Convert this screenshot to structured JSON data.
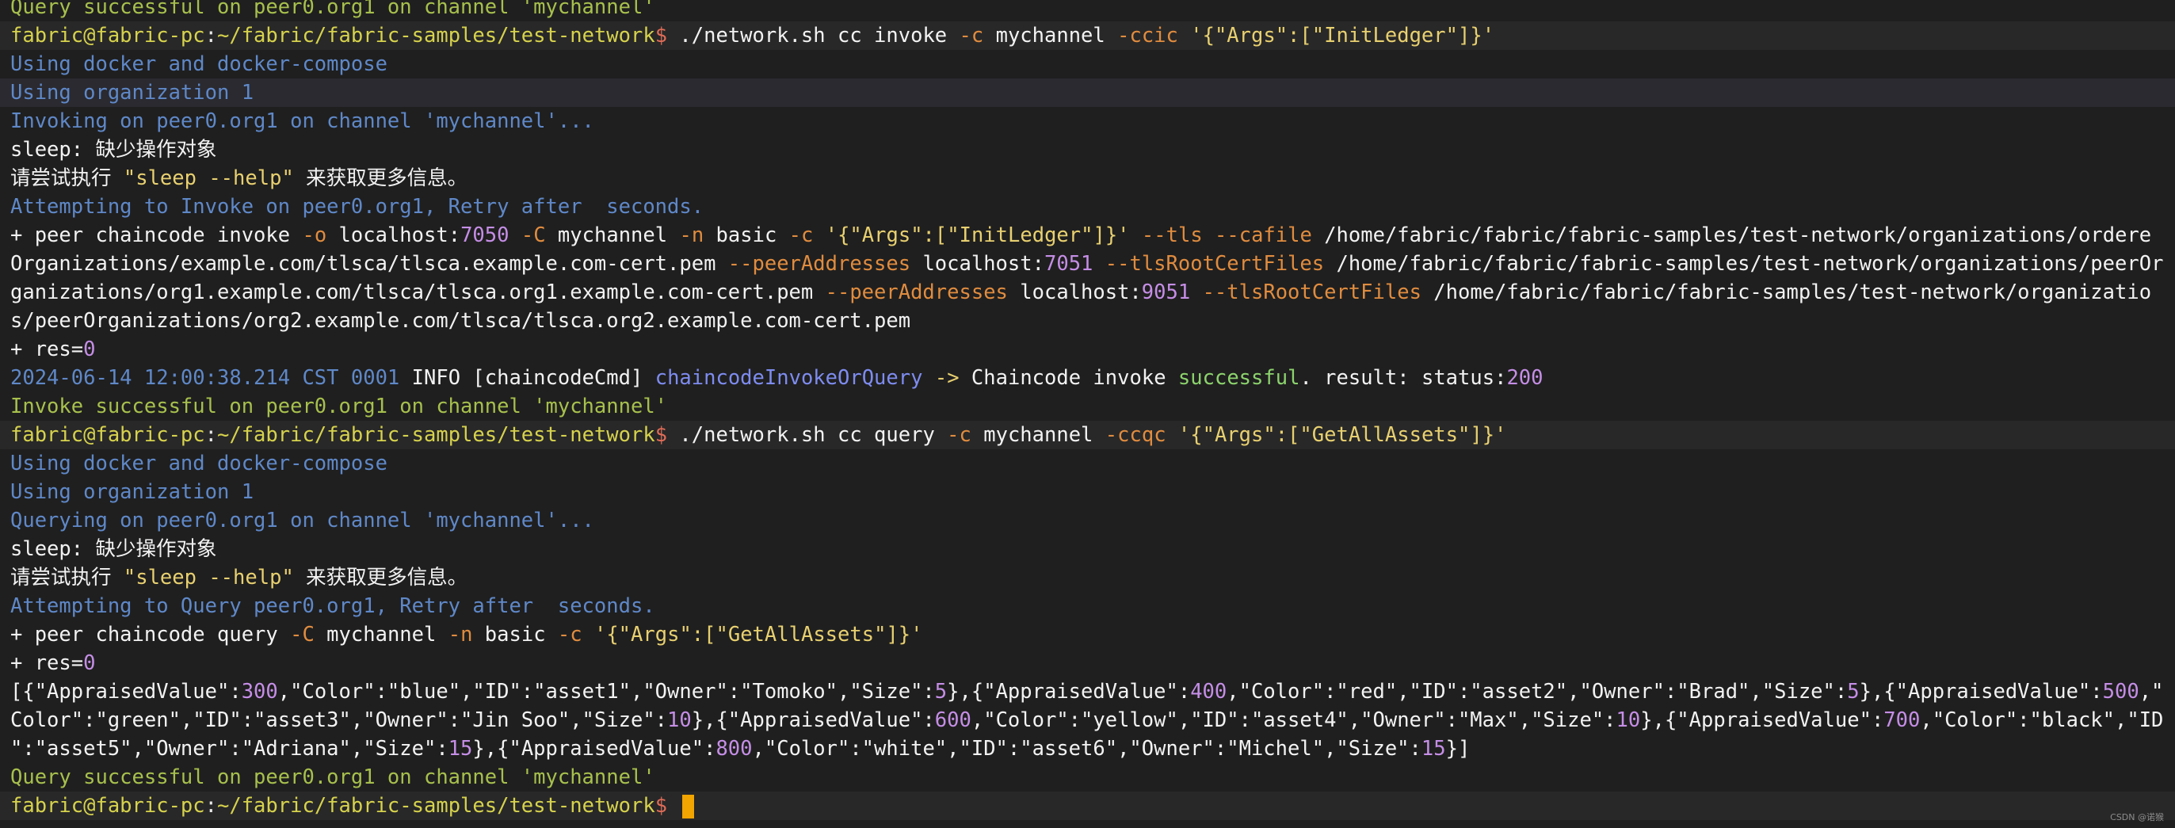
{
  "colors": {
    "background": "#1f1f1f",
    "prompt_background": "#282828",
    "success": "#a7c04d",
    "info_blue": "#5f88c8",
    "flag_orange": "#e08c3f",
    "number_purple": "#c58ee6",
    "cursor": "#f2a400"
  },
  "watermark": "CSDN @诺猴",
  "lines": [
    {
      "kind": "normal",
      "tokens": [
        {
          "t": "Query successful on peer0.org1 on channel 'mychannel'",
          "c": "c-success"
        }
      ]
    },
    {
      "kind": "prompt",
      "tokens": [
        {
          "t": "fabric@fabric-pc",
          "c": "c-prompt"
        },
        {
          "t": ":",
          "c": "c-plain"
        },
        {
          "t": "~/fabric/fabric-samples/test-network",
          "c": "c-path"
        },
        {
          "t": "$ ",
          "c": "c-dollar"
        },
        {
          "t": "./network.sh cc invoke ",
          "c": "c-white"
        },
        {
          "t": "-c",
          "c": "c-flag"
        },
        {
          "t": " mychannel ",
          "c": "c-white"
        },
        {
          "t": "-ccic",
          "c": "c-flag"
        },
        {
          "t": " '{\"Args\":[\"InitLedger\"]}'",
          "c": "c-str"
        }
      ]
    },
    {
      "kind": "normal",
      "tokens": [
        {
          "t": "Using docker and docker-compose",
          "c": "c-blue"
        }
      ]
    },
    {
      "kind": "hl",
      "tokens": [
        {
          "t": "Using organization 1",
          "c": "c-blue"
        }
      ]
    },
    {
      "kind": "normal",
      "tokens": [
        {
          "t": "Invoking on peer0.org1 on channel 'mychannel'...",
          "c": "c-blue"
        }
      ]
    },
    {
      "kind": "normal",
      "tokens": [
        {
          "t": "sleep",
          "c": "c-white"
        },
        {
          "t": ": 缺少操作对象",
          "c": "c-white"
        }
      ]
    },
    {
      "kind": "normal",
      "tokens": [
        {
          "t": "请尝试执行 ",
          "c": "c-white"
        },
        {
          "t": "\"sleep --help\"",
          "c": "c-str"
        },
        {
          "t": " 来获取更多信息。",
          "c": "c-white"
        }
      ]
    },
    {
      "kind": "normal",
      "tokens": [
        {
          "t": "Attempting to Invoke on peer0.org1, Retry after  seconds.",
          "c": "c-blue"
        }
      ]
    },
    {
      "kind": "normal",
      "tokens": [
        {
          "t": "+ peer chaincode invoke ",
          "c": "c-white"
        },
        {
          "t": "-o",
          "c": "c-flag"
        },
        {
          "t": " localhost:",
          "c": "c-white"
        },
        {
          "t": "7050",
          "c": "c-num"
        },
        {
          "t": " ",
          "c": "c-white"
        },
        {
          "t": "-C",
          "c": "c-flag"
        },
        {
          "t": " mychannel ",
          "c": "c-white"
        },
        {
          "t": "-n",
          "c": "c-flag"
        },
        {
          "t": " basic ",
          "c": "c-white"
        },
        {
          "t": "-c",
          "c": "c-flag"
        },
        {
          "t": " '{\"Args\":[\"InitLedger\"]}'",
          "c": "c-str"
        },
        {
          "t": " ",
          "c": "c-white"
        },
        {
          "t": "--tls --cafile",
          "c": "c-flag"
        },
        {
          "t": " /home/fabric/fabric/fabric-samples/test-network/organizations/ordere",
          "c": "c-white"
        }
      ]
    },
    {
      "kind": "normal",
      "tokens": [
        {
          "t": "Organizations/example.com/tlsca/tlsca.example.com-cert.pem ",
          "c": "c-white"
        },
        {
          "t": "--peerAddresses",
          "c": "c-flag"
        },
        {
          "t": " localhost:",
          "c": "c-white"
        },
        {
          "t": "7051",
          "c": "c-num"
        },
        {
          "t": " ",
          "c": "c-white"
        },
        {
          "t": "--tlsRootCertFiles",
          "c": "c-flag"
        },
        {
          "t": " /home/fabric/fabric/fabric-samples/test-network/organizations/peerOr",
          "c": "c-white"
        }
      ]
    },
    {
      "kind": "normal",
      "tokens": [
        {
          "t": "ganizations/org1.example.com/tlsca/tlsca.org1.example.com-cert.pem ",
          "c": "c-white"
        },
        {
          "t": "--peerAddresses",
          "c": "c-flag"
        },
        {
          "t": " localhost:",
          "c": "c-white"
        },
        {
          "t": "9051",
          "c": "c-num"
        },
        {
          "t": " ",
          "c": "c-white"
        },
        {
          "t": "--tlsRootCertFiles",
          "c": "c-flag"
        },
        {
          "t": " /home/fabric/fabric/fabric-samples/test-network/organizatio",
          "c": "c-white"
        }
      ]
    },
    {
      "kind": "normal",
      "tokens": [
        {
          "t": "s/peerOrganizations/org2.example.com/tlsca/tlsca.org2.example.com-cert.pem",
          "c": "c-white"
        }
      ]
    },
    {
      "kind": "normal",
      "tokens": [
        {
          "t": "+ res=",
          "c": "c-white"
        },
        {
          "t": "0",
          "c": "c-num"
        }
      ]
    },
    {
      "kind": "normal",
      "tokens": [
        {
          "t": "2024-06-14 12:00:38.214 CST 0001",
          "c": "c-blue"
        },
        {
          "t": " INFO ",
          "c": "c-white"
        },
        {
          "t": "[",
          "c": "c-white"
        },
        {
          "t": "chaincodeCmd",
          "c": "c-white"
        },
        {
          "t": "] ",
          "c": "c-white"
        },
        {
          "t": "chaincodeInvokeOrQuery",
          "c": "c-chain"
        },
        {
          "t": " -> ",
          "c": "c-str"
        },
        {
          "t": "Chaincode invoke ",
          "c": "c-white"
        },
        {
          "t": "successful",
          "c": "c-green"
        },
        {
          "t": ". result: status:",
          "c": "c-white"
        },
        {
          "t": "200",
          "c": "c-num"
        }
      ]
    },
    {
      "kind": "normal",
      "tokens": [
        {
          "t": "Invoke successful on peer0.org1 on channel 'mychannel'",
          "c": "c-success"
        }
      ]
    },
    {
      "kind": "prompt",
      "tokens": [
        {
          "t": "fabric@fabric-pc",
          "c": "c-prompt"
        },
        {
          "t": ":",
          "c": "c-plain"
        },
        {
          "t": "~/fabric/fabric-samples/test-network",
          "c": "c-path"
        },
        {
          "t": "$ ",
          "c": "c-dollar"
        },
        {
          "t": "./network.sh cc query ",
          "c": "c-white"
        },
        {
          "t": "-c",
          "c": "c-flag"
        },
        {
          "t": " mychannel ",
          "c": "c-white"
        },
        {
          "t": "-ccqc",
          "c": "c-flag"
        },
        {
          "t": " '{\"Args\":[\"GetAllAssets\"]}'",
          "c": "c-str"
        }
      ]
    },
    {
      "kind": "normal",
      "tokens": [
        {
          "t": "Using docker and docker-compose",
          "c": "c-blue"
        }
      ]
    },
    {
      "kind": "normal",
      "tokens": [
        {
          "t": "Using organization 1",
          "c": "c-blue"
        }
      ]
    },
    {
      "kind": "normal",
      "tokens": [
        {
          "t": "Querying on peer0.org1 on channel 'mychannel'...",
          "c": "c-blue"
        }
      ]
    },
    {
      "kind": "normal",
      "tokens": [
        {
          "t": "sleep",
          "c": "c-white"
        },
        {
          "t": ": 缺少操作对象",
          "c": "c-white"
        }
      ]
    },
    {
      "kind": "normal",
      "tokens": [
        {
          "t": "请尝试执行 ",
          "c": "c-white"
        },
        {
          "t": "\"sleep --help\"",
          "c": "c-str"
        },
        {
          "t": " 来获取更多信息。",
          "c": "c-white"
        }
      ]
    },
    {
      "kind": "normal",
      "tokens": [
        {
          "t": "Attempting to Query peer0.org1, Retry after  seconds.",
          "c": "c-blue"
        }
      ]
    },
    {
      "kind": "normal",
      "tokens": [
        {
          "t": "+ peer chaincode query ",
          "c": "c-white"
        },
        {
          "t": "-C",
          "c": "c-flag"
        },
        {
          "t": " mychannel ",
          "c": "c-white"
        },
        {
          "t": "-n",
          "c": "c-flag"
        },
        {
          "t": " basic ",
          "c": "c-white"
        },
        {
          "t": "-c",
          "c": "c-flag"
        },
        {
          "t": " '{\"Args\":[\"GetAllAssets\"]}'",
          "c": "c-str"
        }
      ]
    },
    {
      "kind": "normal",
      "tokens": [
        {
          "t": "+ res=",
          "c": "c-white"
        },
        {
          "t": "0",
          "c": "c-num"
        }
      ]
    },
    {
      "kind": "normal",
      "tokens": [
        {
          "t": "[{\"AppraisedValue\":",
          "c": "c-white"
        },
        {
          "t": "300",
          "c": "c-num"
        },
        {
          "t": ",\"Color\":\"blue\",\"ID\":\"asset1\",\"Owner\":\"Tomoko\",\"Size\":",
          "c": "c-white"
        },
        {
          "t": "5",
          "c": "c-num"
        },
        {
          "t": "},{\"AppraisedValue\":",
          "c": "c-white"
        },
        {
          "t": "400",
          "c": "c-num"
        },
        {
          "t": ",\"Color\":\"red\",\"ID\":\"asset2\",\"Owner\":\"Brad\",\"Size\":",
          "c": "c-white"
        },
        {
          "t": "5",
          "c": "c-num"
        },
        {
          "t": "},{\"AppraisedValue\":",
          "c": "c-white"
        },
        {
          "t": "500",
          "c": "c-num"
        },
        {
          "t": ",\"",
          "c": "c-white"
        }
      ]
    },
    {
      "kind": "normal",
      "tokens": [
        {
          "t": "Color\":\"green\",\"ID\":\"asset3\",\"Owner\":\"Jin Soo\",\"Size\":",
          "c": "c-white"
        },
        {
          "t": "10",
          "c": "c-num"
        },
        {
          "t": "},{\"AppraisedValue\":",
          "c": "c-white"
        },
        {
          "t": "600",
          "c": "c-num"
        },
        {
          "t": ",\"Color\":\"yellow\",\"ID\":\"asset4\",\"Owner\":\"Max\",\"Size\":",
          "c": "c-white"
        },
        {
          "t": "10",
          "c": "c-num"
        },
        {
          "t": "},{\"AppraisedValue\":",
          "c": "c-white"
        },
        {
          "t": "700",
          "c": "c-num"
        },
        {
          "t": ",\"Color\":\"black\",\"ID",
          "c": "c-white"
        }
      ]
    },
    {
      "kind": "normal",
      "tokens": [
        {
          "t": "\":\"asset5\",\"Owner\":\"Adriana\",\"Size\":",
          "c": "c-white"
        },
        {
          "t": "15",
          "c": "c-num"
        },
        {
          "t": "},{\"AppraisedValue\":",
          "c": "c-white"
        },
        {
          "t": "800",
          "c": "c-num"
        },
        {
          "t": ",\"Color\":\"white\",\"ID\":\"asset6\",\"Owner\":\"Michel\",\"Size\":",
          "c": "c-white"
        },
        {
          "t": "15",
          "c": "c-num"
        },
        {
          "t": "}]",
          "c": "c-white"
        }
      ]
    },
    {
      "kind": "normal",
      "tokens": [
        {
          "t": "Query successful on peer0.org1 on channel 'mychannel'",
          "c": "c-success"
        }
      ]
    },
    {
      "kind": "prompt",
      "cursor": true,
      "tokens": [
        {
          "t": "fabric@fabric-pc",
          "c": "c-prompt"
        },
        {
          "t": ":",
          "c": "c-plain"
        },
        {
          "t": "~/fabric/fabric-samples/test-network",
          "c": "c-path"
        },
        {
          "t": "$ ",
          "c": "c-dollar"
        }
      ]
    }
  ]
}
